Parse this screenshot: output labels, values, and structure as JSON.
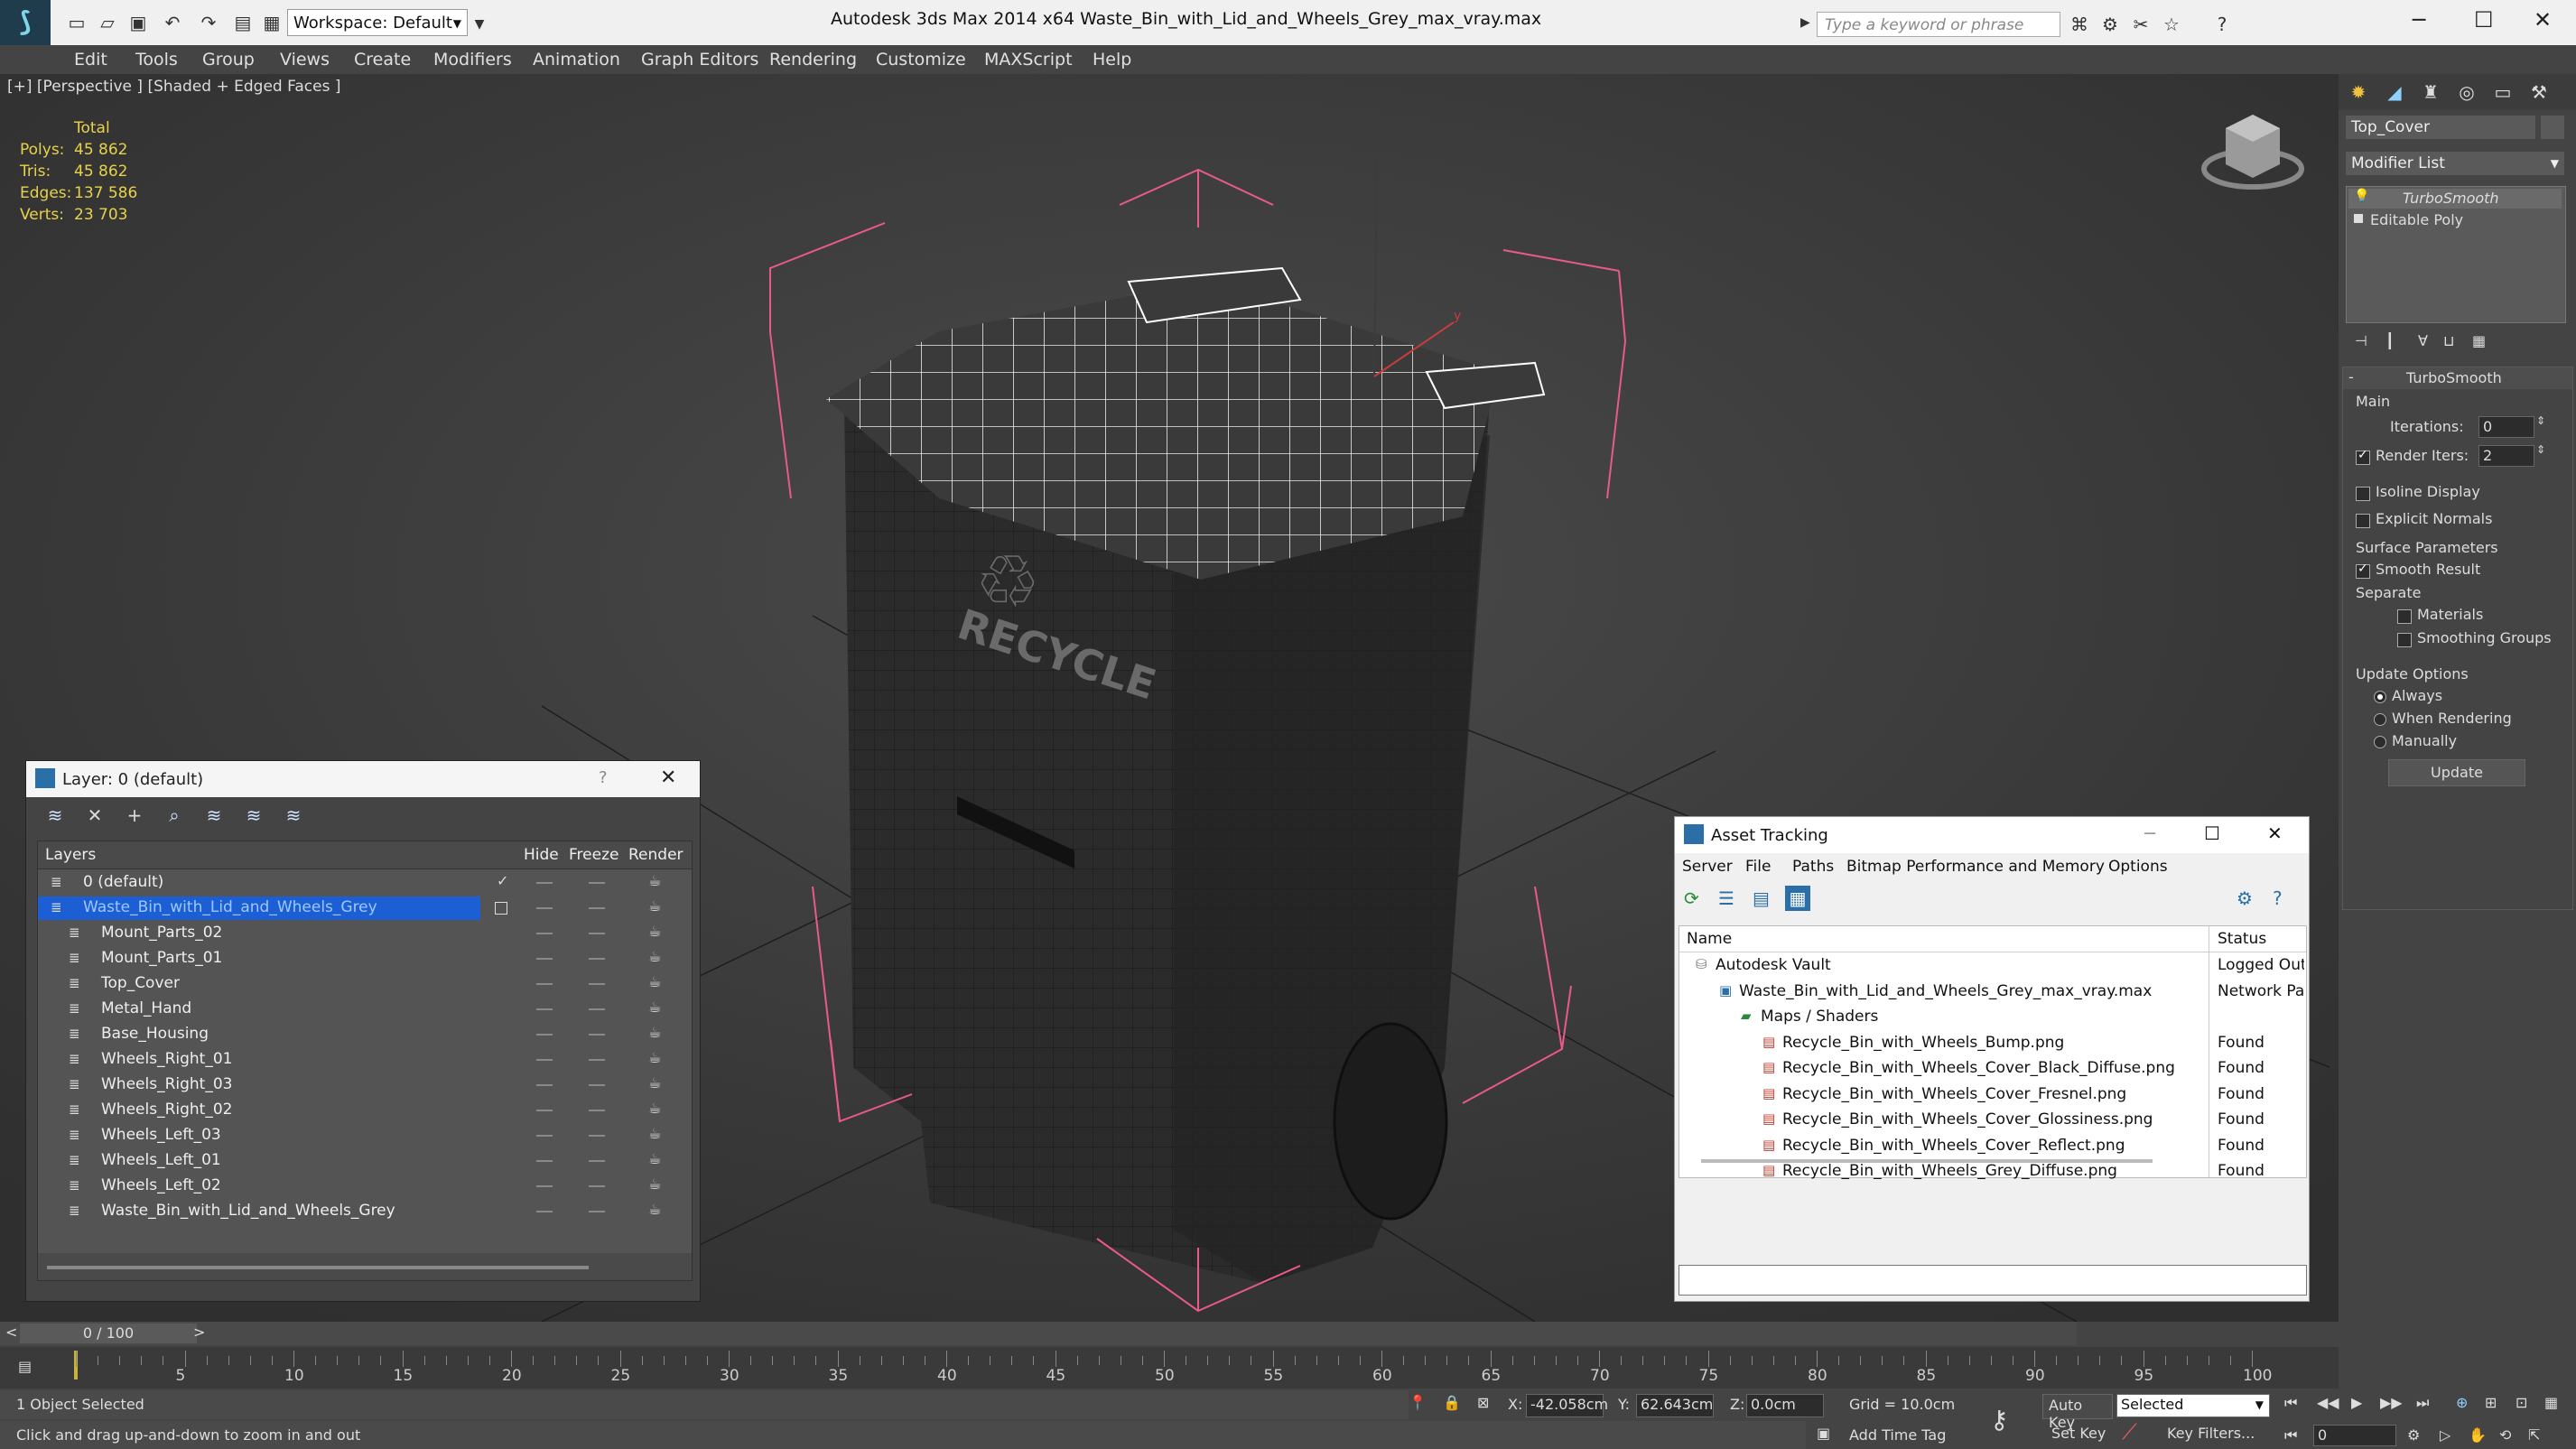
{
  "app": {
    "title": "Autodesk 3ds Max  2014 x64      Waste_Bin_with_Lid_and_Wheels_Grey_max_vray.max",
    "workspace_value": "Workspace: Default",
    "search_placeholder": "Type a keyword or phrase"
  },
  "menu": [
    "Edit",
    "Tools",
    "Group",
    "Views",
    "Create",
    "Modifiers",
    "Animation",
    "Graph Editors",
    "Rendering",
    "Customize",
    "MAXScript",
    "Help"
  ],
  "viewport": {
    "label": "[+] [Perspective ] [Shaded + Edged Faces ]",
    "stats": {
      "header": "Total",
      "rows": [
        {
          "label": "Polys:",
          "value": "45 862"
        },
        {
          "label": "Tris:",
          "value": "45 862"
        },
        {
          "label": "Edges:",
          "value": "137 586"
        },
        {
          "label": "Verts:",
          "value": "23 703"
        }
      ]
    },
    "recycle_text": "RECYCLE"
  },
  "command_panel": {
    "object_name": "Top_Cover",
    "modifier_list": "Modifier List",
    "stack": [
      "TurboSmooth",
      "Editable Poly"
    ],
    "rollout_title": "TurboSmooth",
    "main_label": "Main",
    "iterations_label": "Iterations:",
    "iterations_value": "0",
    "render_iters_label": "Render Iters:",
    "render_iters_value": "2",
    "isoline_label": "Isoline Display",
    "explicit_normals_label": "Explicit Normals",
    "surface_params_label": "Surface Parameters",
    "smooth_result_label": "Smooth Result",
    "separate_label": "Separate",
    "materials_label": "Materials",
    "smoothing_groups_label": "Smoothing Groups",
    "update_options_label": "Update Options",
    "always_label": "Always",
    "when_rendering_label": "When Rendering",
    "manually_label": "Manually",
    "update_button": "Update"
  },
  "layer_dialog": {
    "title": "Layer: 0 (default)",
    "help": "?",
    "columns": {
      "layers": "Layers",
      "hide": "Hide",
      "freeze": "Freeze",
      "render": "Render"
    },
    "rows": [
      {
        "name": "0 (default)",
        "level": 0
      },
      {
        "name": "Waste_Bin_with_Lid_and_Wheels_Grey",
        "level": 0,
        "selected": true
      },
      {
        "name": "Mount_Parts_02",
        "level": 1
      },
      {
        "name": "Mount_Parts_01",
        "level": 1
      },
      {
        "name": "Top_Cover",
        "level": 1
      },
      {
        "name": "Metal_Hand",
        "level": 1
      },
      {
        "name": "Base_Housing",
        "level": 1
      },
      {
        "name": "Wheels_Right_01",
        "level": 1
      },
      {
        "name": "Wheels_Right_03",
        "level": 1
      },
      {
        "name": "Wheels_Right_02",
        "level": 1
      },
      {
        "name": "Wheels_Left_03",
        "level": 1
      },
      {
        "name": "Wheels_Left_01",
        "level": 1
      },
      {
        "name": "Wheels_Left_02",
        "level": 1
      },
      {
        "name": "Waste_Bin_with_Lid_and_Wheels_Grey",
        "level": 1
      }
    ]
  },
  "asset_dialog": {
    "title": "Asset Tracking",
    "menu": [
      "Server",
      "File",
      "Paths",
      "Bitmap Performance and Memory",
      "Options"
    ],
    "columns": {
      "name": "Name",
      "status": "Status"
    },
    "rows": [
      {
        "name": "Autodesk Vault",
        "status": "Logged Out",
        "level": 0
      },
      {
        "name": "Waste_Bin_with_Lid_and_Wheels_Grey_max_vray.max",
        "status": "Network Pat",
        "level": 1
      },
      {
        "name": "Maps / Shaders",
        "status": "",
        "level": 2
      },
      {
        "name": "Recycle_Bin_with_Wheels_Bump.png",
        "status": "Found",
        "level": 3
      },
      {
        "name": "Recycle_Bin_with_Wheels_Cover_Black_Diffuse.png",
        "status": "Found",
        "level": 3
      },
      {
        "name": "Recycle_Bin_with_Wheels_Cover_Fresnel.png",
        "status": "Found",
        "level": 3
      },
      {
        "name": "Recycle_Bin_with_Wheels_Cover_Glossiness.png",
        "status": "Found",
        "level": 3
      },
      {
        "name": "Recycle_Bin_with_Wheels_Cover_Reflect.png",
        "status": "Found",
        "level": 3
      },
      {
        "name": "Recycle_Bin_with_Wheels_Grey_Diffuse.png",
        "status": "Found",
        "level": 3
      }
    ]
  },
  "timeline": {
    "frame_counter": "0 / 100",
    "ticks": [
      "5",
      "10",
      "15",
      "20",
      "25",
      "30",
      "35",
      "40",
      "45",
      "50",
      "55",
      "60",
      "65",
      "70",
      "75",
      "80",
      "85",
      "90",
      "95",
      "100"
    ]
  },
  "status": {
    "selection": "1 Object Selected",
    "prompt": "Click and drag up-and-down to zoom in and out",
    "x_label": "X:",
    "x_value": "-42.058cm",
    "y_label": "Y:",
    "y_value": "62.643cm",
    "z_label": "Z:",
    "z_value": "0.0cm",
    "grid": "Grid = 10.0cm",
    "auto_key": "Auto Key",
    "selected_value": "Selected",
    "set_key": "Set Key",
    "key_filters": "Key Filters...",
    "add_time_tag": "Add Time Tag",
    "current_frame": "0"
  },
  "colors": {
    "selection": "#1c5fd4",
    "stat_yellow": "#e8d24a",
    "gizmo_pink": "#e85a8a"
  }
}
